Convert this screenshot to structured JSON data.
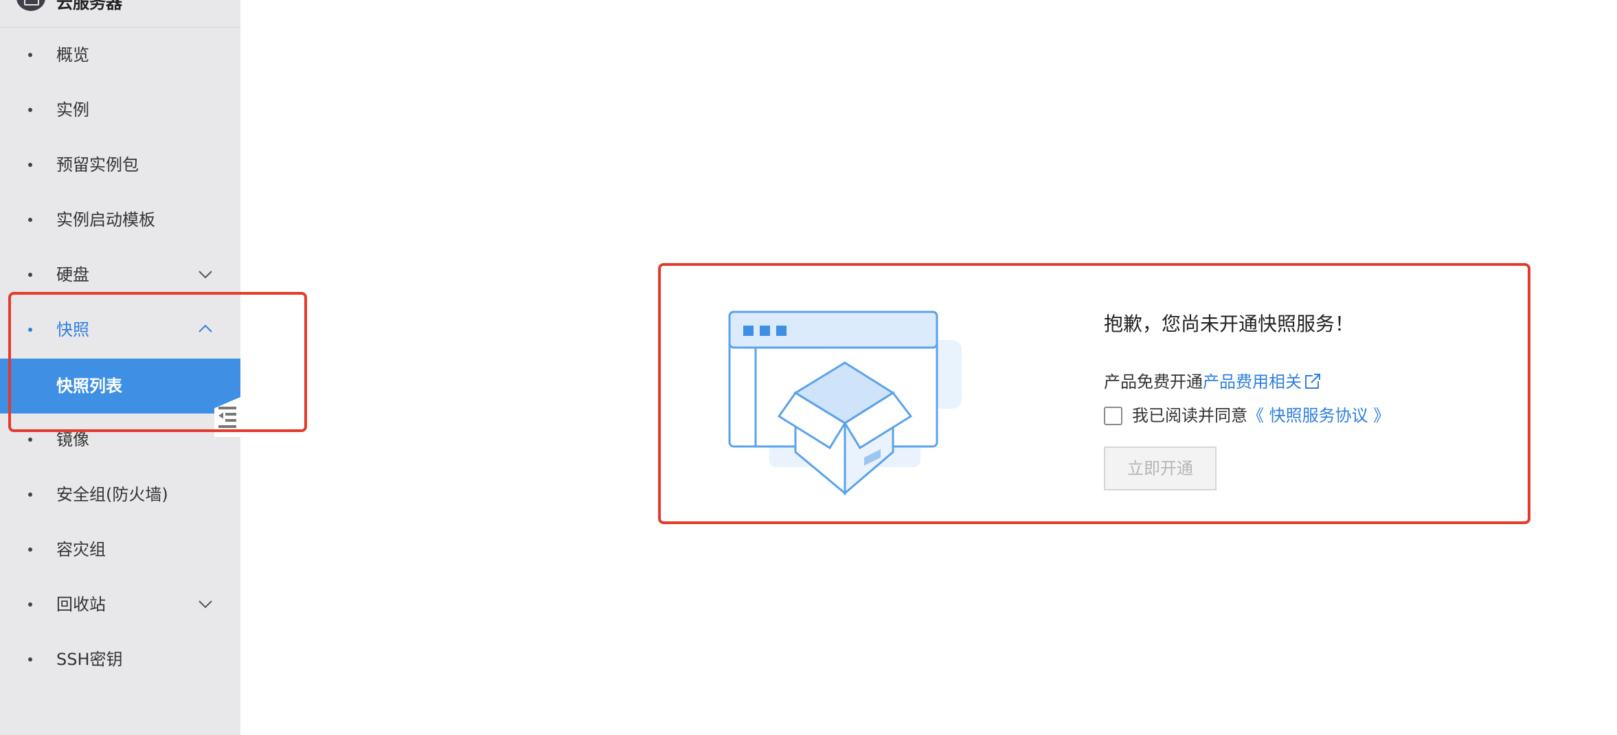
{
  "sidebar": {
    "header_title": "云服务器",
    "items": [
      {
        "label": "概览"
      },
      {
        "label": "实例"
      },
      {
        "label": "预留实例包"
      },
      {
        "label": "实例启动模板"
      },
      {
        "label": "硬盘"
      },
      {
        "label": "快照"
      },
      {
        "label": "镜像"
      },
      {
        "label": "安全组(防火墙)"
      },
      {
        "label": "容灾组"
      },
      {
        "label": "回收站"
      },
      {
        "label": "SSH密钥"
      }
    ],
    "snapshot_submenu": [
      {
        "label": "快照列表"
      }
    ],
    "active_item": "快照",
    "active_subitem": "快照列表"
  },
  "main": {
    "title": "抱歉，您尚未开通快照服务！",
    "free_text": "产品免费开通",
    "fee_link": "产品费用相关",
    "agree_text": "我已阅读并同意",
    "agreement_link": "《 快照服务协议 》",
    "activate_button": "立即开通",
    "checkbox_checked": false,
    "activate_enabled": false
  },
  "colors": {
    "accent": "#2d7fde",
    "active_bg": "#3f8fe4",
    "sidebar_bg": "#e8e8eb",
    "annotation_red": "#e53a2b"
  }
}
